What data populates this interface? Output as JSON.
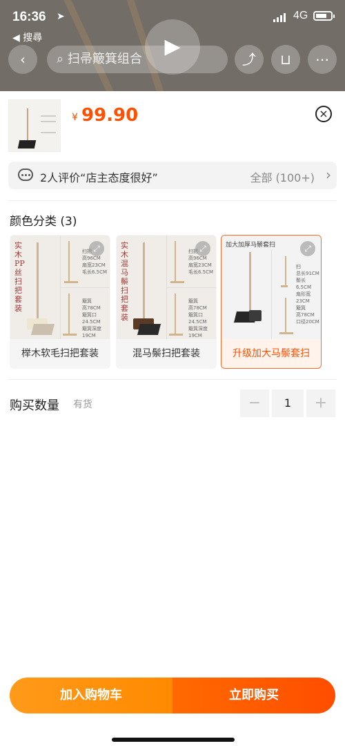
{
  "status_bar": {
    "time": "16:36",
    "back_app": "◀ 搜尋",
    "network": "4G"
  },
  "background_nav": {
    "search_placeholder": "扫帚簸箕组合"
  },
  "product": {
    "price_symbol": "¥",
    "price": "99.90"
  },
  "review": {
    "text": "2人评价“店主态度很好”",
    "all_label": "全部 (100+)"
  },
  "variants": {
    "title": "颜色分类 (3)",
    "options": [
      {
        "label": "榉木软毛扫把套装",
        "image_text": "实木PP丝扫把套装",
        "selected": false
      },
      {
        "label": "混马鬃扫把套装",
        "image_text": "实木混马鬃扫把套装",
        "selected": false
      },
      {
        "label": "升级加大马鬃套扫",
        "image_text": "加大加厚马鬃套扫",
        "selected": true
      }
    ]
  },
  "quantity": {
    "label": "购买数量",
    "stock": "有货",
    "value": "1",
    "minus": "−",
    "plus": "+"
  },
  "actions": {
    "add_to_cart": "加入购物车",
    "buy_now": "立即购买"
  },
  "colors": {
    "accent": "#ff5000",
    "cart_button": "#ff9000",
    "buy_button": "#ff5000"
  }
}
